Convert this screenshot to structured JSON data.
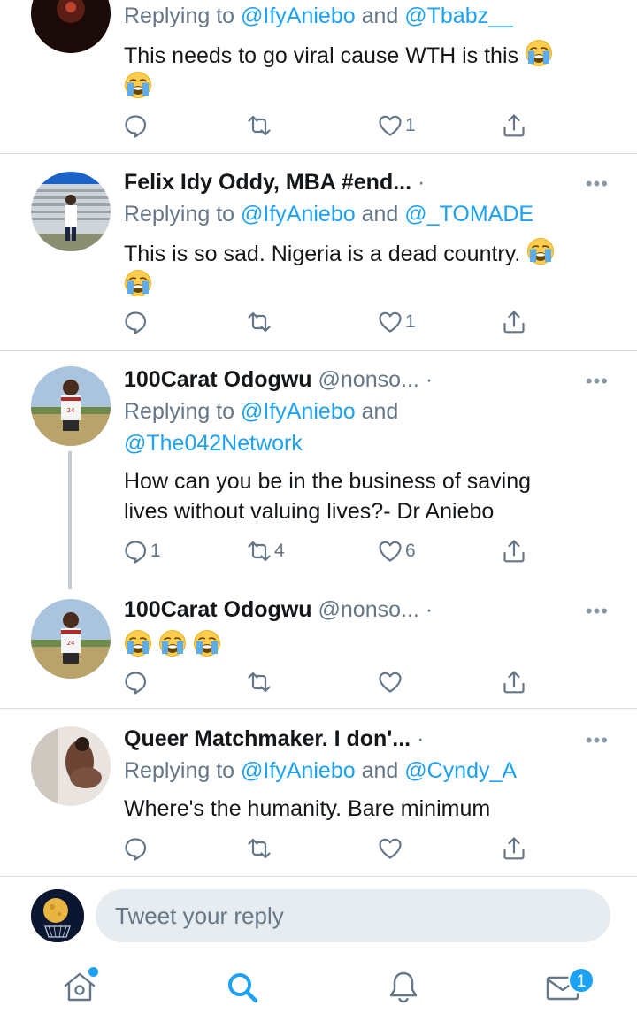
{
  "tweets": [
    {
      "author": "",
      "handle": "",
      "replying_prefix": "Replying to",
      "mentions": [
        "@IfyAniebo",
        "@Tbabz__"
      ],
      "text": "This needs to go viral cause WTH is this",
      "emoji_count": 1,
      "replies": "",
      "retweets": "",
      "likes": "1"
    },
    {
      "author": "Felix Idy Oddy, MBA #end...",
      "handle": "",
      "replying_prefix": "Replying to",
      "mentions": [
        "@IfyAniebo",
        "@_TOMADE"
      ],
      "text": "This is so sad. Nigeria is a dead country.",
      "emoji_count": 1,
      "replies": "",
      "retweets": "",
      "likes": "1"
    },
    {
      "author": "100Carat Odogwu",
      "handle": "@nonso...",
      "replying_prefix": "Replying to",
      "mentions": [
        "@IfyAniebo",
        "@The042Network"
      ],
      "text": "How can you be in the business of saving lives without valuing lives?- Dr Aniebo",
      "emoji_count": 0,
      "replies": "1",
      "retweets": "4",
      "likes": "6"
    },
    {
      "author": "100Carat Odogwu",
      "handle": "@nonso...",
      "text": "",
      "emoji_count": 3,
      "replies": "",
      "retweets": "",
      "likes": ""
    },
    {
      "author": "Queer Matchmaker. I don'...",
      "handle": "",
      "replying_prefix": "Replying to",
      "mentions": [
        "@IfyAniebo",
        "@Cyndy_A"
      ],
      "text": "Where's the humanity. Bare minimum",
      "emoji_count": 0,
      "replies": "",
      "retweets": "",
      "likes": ""
    }
  ],
  "conjunction": "and",
  "more_label": "•••",
  "separator_dot": "·",
  "composer": {
    "placeholder": "Tweet your reply"
  },
  "tabbar": {
    "items": [
      "home-icon",
      "search-icon",
      "notifications-icon",
      "messages-icon"
    ],
    "messages_badge": "1",
    "active": "search"
  },
  "colors": {
    "accent": "#1da1f2",
    "muted": "#657786",
    "border": "#d7dde2",
    "text": "#14171a"
  }
}
